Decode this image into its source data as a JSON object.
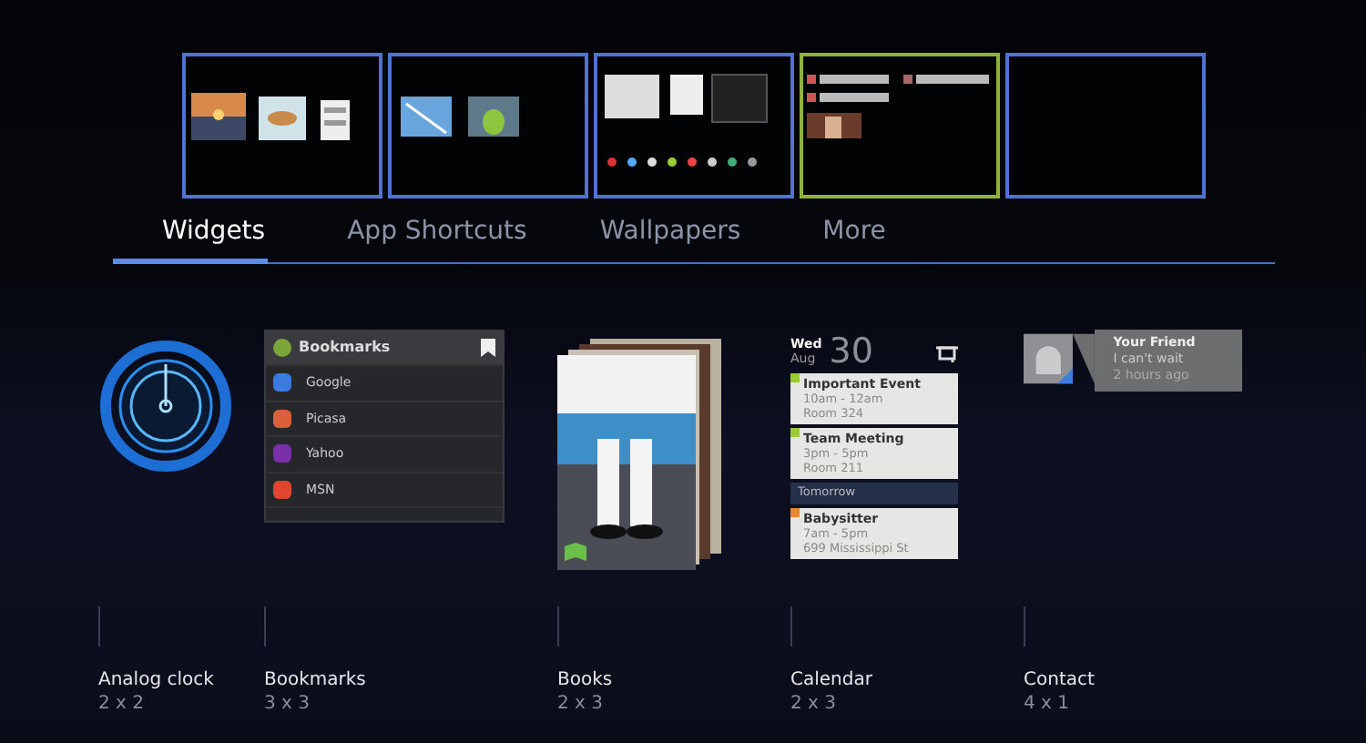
{
  "home_screens": [
    {
      "kind": "photos",
      "selected": false
    },
    {
      "kind": "pictures",
      "selected": false
    },
    {
      "kind": "apps",
      "selected": false
    },
    {
      "kind": "contacts",
      "selected": true
    },
    {
      "kind": "empty",
      "selected": false
    }
  ],
  "tabs": [
    {
      "label": "Widgets",
      "selected": true
    },
    {
      "label": "App Shortcuts",
      "selected": false
    },
    {
      "label": "Wallpapers",
      "selected": false
    },
    {
      "label": "More",
      "selected": false
    }
  ],
  "widgets": [
    {
      "kind": "clock",
      "name": "Analog clock",
      "size": "2 x 2"
    },
    {
      "kind": "bookmarks",
      "name": "Bookmarks",
      "size": "3 x 3",
      "title": "Bookmarks",
      "items": [
        {
          "label": "Google",
          "color": "#3a7be0"
        },
        {
          "label": "Picasa",
          "color": "#d9603b"
        },
        {
          "label": "Yahoo",
          "color": "#7b2fa8"
        },
        {
          "label": "MSN",
          "color": "#e0452f"
        }
      ]
    },
    {
      "kind": "books",
      "name": "Books",
      "size": "2 x 3"
    },
    {
      "kind": "calendar",
      "name": "Calendar",
      "size": "2 x 3",
      "weekday": "Wed",
      "month": "Aug",
      "day": "30",
      "entries": [
        {
          "kind": "event",
          "title": "Important Event",
          "time": "10am - 12am",
          "place": "Room 324",
          "color": "#9acd32"
        },
        {
          "kind": "event",
          "title": "Team Meeting",
          "time": "3pm - 5pm",
          "place": "Room 211",
          "color": "#9acd32"
        },
        {
          "kind": "header",
          "title": "Tomorrow"
        },
        {
          "kind": "event",
          "title": "Babysitter",
          "time": "7am - 5pm",
          "place": "699 Mississippi St",
          "color": "#e8872e"
        }
      ]
    },
    {
      "kind": "contact",
      "name": "Contact",
      "size": "4 x 1",
      "person": "Your Friend",
      "message": "I can't wait",
      "time": "2 hours ago"
    }
  ]
}
